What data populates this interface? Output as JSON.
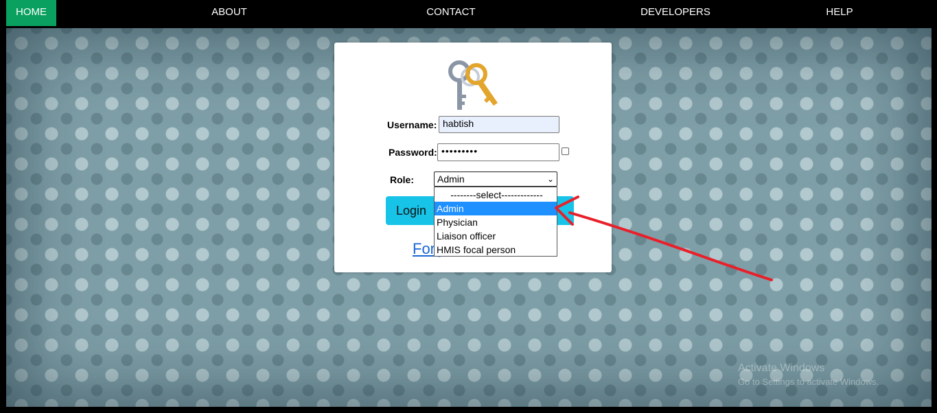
{
  "nav": {
    "items": [
      {
        "label": "HOME",
        "active": true
      },
      {
        "label": "ABOUT"
      },
      {
        "label": "CONTACT"
      },
      {
        "label": "DEVELOPERS"
      },
      {
        "label": "HELP"
      }
    ]
  },
  "login": {
    "username_label": "Username:",
    "username_value": "habtish",
    "password_label": "Password:",
    "password_value": "•••••••••",
    "role_label": "Role:",
    "role_selected": "Admin",
    "button_label": "Login",
    "forgot_visible": "Forg",
    "icon": "keys-icon"
  },
  "role_dropdown": {
    "options": [
      "--------select-------------",
      "Admin",
      "Physician",
      "Liaison officer",
      "HMIS focal person"
    ],
    "highlighted": "Admin"
  },
  "watermark": {
    "line1": "Activate Windows",
    "line2": "Go to Settings to activate Windows."
  },
  "colors": {
    "nav_active": "#0aa060",
    "login_button": "#17c3e6",
    "highlight": "#1e90ff",
    "annotation_arrow": "#e8202a"
  }
}
